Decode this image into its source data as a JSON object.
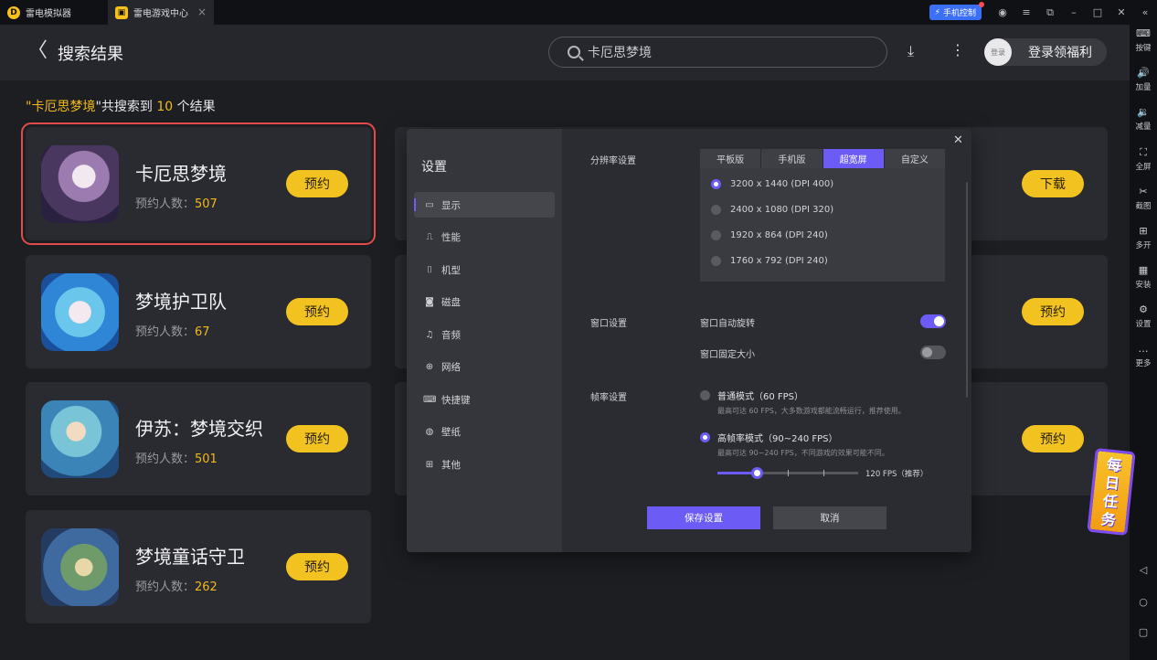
{
  "titlebar": {
    "tabs": [
      {
        "label": "雷电模拟器"
      },
      {
        "label": "雷电游戏中心"
      }
    ],
    "phone_control": "手机控制"
  },
  "header": {
    "title": "搜索结果",
    "search_value": "卡厄思梦境",
    "login_avatar": "登录",
    "login_label": "登录领福利"
  },
  "sidebar": {
    "items": [
      {
        "label": "按键",
        "icon": "keyboard-icon"
      },
      {
        "label": "加量",
        "icon": "volume-up-icon"
      },
      {
        "label": "减量",
        "icon": "volume-down-icon"
      },
      {
        "label": "全屏",
        "icon": "fullscreen-icon"
      },
      {
        "label": "截图",
        "icon": "scissors-icon"
      },
      {
        "label": "多开",
        "icon": "multi-instance-icon"
      },
      {
        "label": "安装",
        "icon": "install-icon"
      },
      {
        "label": "设置",
        "icon": "settings-icon"
      },
      {
        "label": "更多",
        "icon": "more-icon"
      }
    ]
  },
  "results": {
    "prefix": "\"",
    "query": "卡厄思梦境",
    "middle": "\"共搜索到 ",
    "count": "10",
    "suffix": " 个结果",
    "count_label": "预约人数：",
    "items": [
      {
        "name": "卡厄思梦境",
        "count": "507",
        "button": "预约"
      },
      {
        "name": "梦境护卫队",
        "count": "67",
        "button": "预约"
      },
      {
        "name": "伊苏：梦境交织",
        "count": "501",
        "button": "预约"
      },
      {
        "name": "梦境童话守卫",
        "count": "262",
        "button": "预约"
      }
    ],
    "right_buttons": [
      "下载",
      "预约",
      "预约"
    ]
  },
  "badge": {
    "text": "每日任务"
  },
  "settings": {
    "title": "设置",
    "nav": [
      {
        "label": "显示",
        "icon": "monitor-icon"
      },
      {
        "label": "性能",
        "icon": "performance-icon"
      },
      {
        "label": "机型",
        "icon": "device-icon"
      },
      {
        "label": "磁盘",
        "icon": "disk-icon"
      },
      {
        "label": "音频",
        "icon": "audio-icon"
      },
      {
        "label": "网络",
        "icon": "globe-icon"
      },
      {
        "label": "快捷键",
        "icon": "shortcut-icon"
      },
      {
        "label": "壁纸",
        "icon": "palette-icon"
      },
      {
        "label": "其他",
        "icon": "grid-icon"
      }
    ],
    "resolution": {
      "label": "分辨率设置",
      "tabs": [
        "平板版",
        "手机版",
        "超宽屏",
        "自定义"
      ],
      "options": [
        "3200 x 1440 (DPI 400)",
        "2400 x 1080 (DPI 320)",
        "1920 x 864 (DPI 240)",
        "1760 x 792 (DPI 240)"
      ]
    },
    "window": {
      "label": "窗口设置",
      "auto_rotate": "窗口自动旋转",
      "fixed_size": "窗口固定大小"
    },
    "fps": {
      "label": "帧率设置",
      "normal": "普通模式（60 FPS）",
      "normal_desc": "最高可达 60 FPS，大多数游戏都能流畅运行，推荐使用。",
      "high": "高帧率模式（90~240 FPS）",
      "high_desc": "最高可达 90~240 FPS，不同游戏的效果可能不同。",
      "slider_value": "120 FPS（推荐）",
      "slider_fraction": 0.28
    },
    "save": "保存设置",
    "cancel": "取消"
  }
}
